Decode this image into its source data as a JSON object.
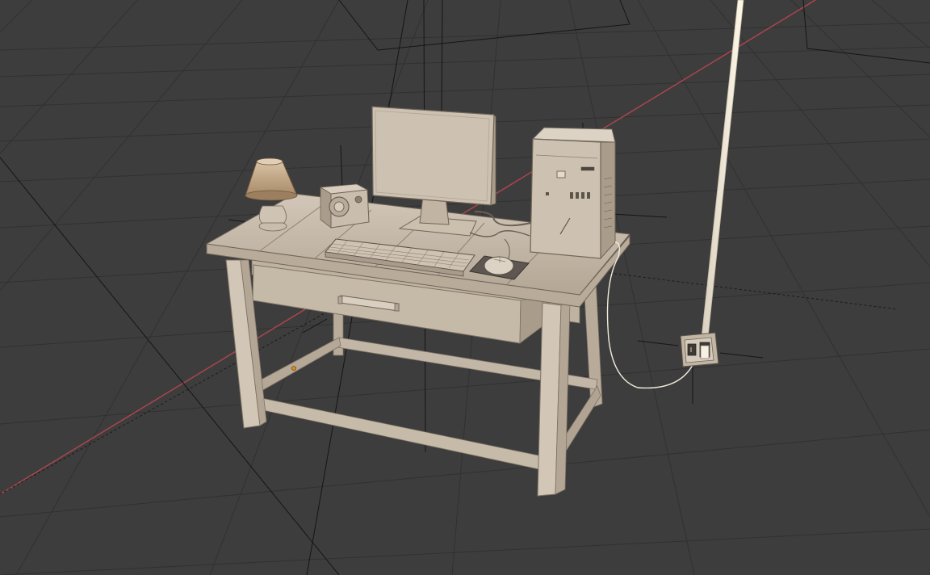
{
  "viewport": {
    "background": "#3d3d3d",
    "grid_color": "#303030",
    "x_axis_color": "#b0464e",
    "object_color": "#c7bbac",
    "shade_color": "#a89b8b",
    "dark_color": "#7d7266",
    "lamp_shade_color": "#b7997a",
    "cable_color": "#f2ecdc"
  },
  "scene_objects": [
    "desk",
    "drawer",
    "monitor",
    "keyboard",
    "mouse",
    "mouse-pad",
    "speaker",
    "table-lamp",
    "pc-tower",
    "wall-outlet",
    "power-cable",
    "floor-lamp-pole"
  ]
}
